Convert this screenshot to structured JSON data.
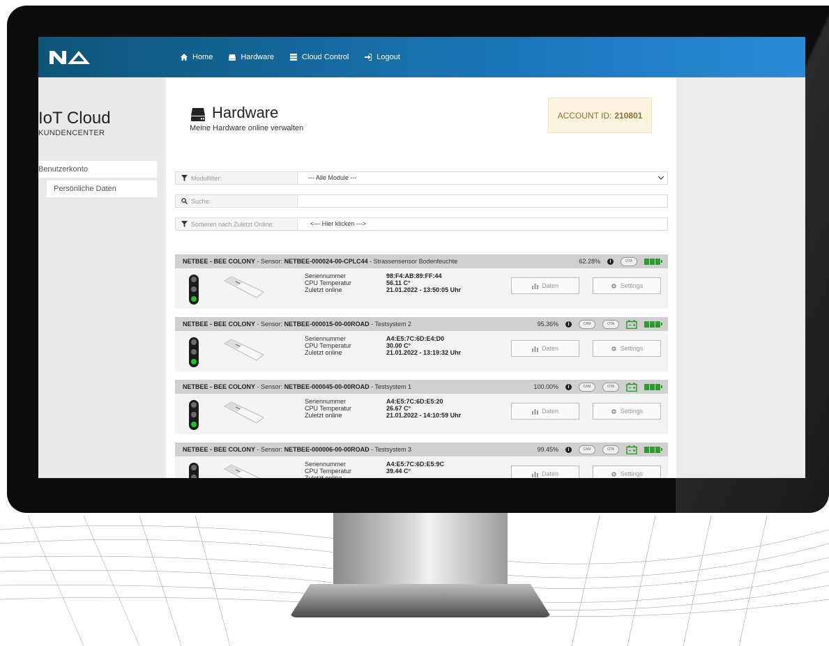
{
  "nav": {
    "home": "Home",
    "hardware": "Hardware",
    "cloud_control": "Cloud Control",
    "logout": "Logout"
  },
  "sidebar": {
    "title": "IoT Cloud",
    "subtitle": "KUNDENCENTER",
    "section": "Benutzerkonto",
    "item": "Persönliche Daten"
  },
  "header": {
    "title": "Hardware",
    "subtitle": "Meine Hardware online verwalten",
    "account_label": "ACCOUNT ID:",
    "account_id": "210801"
  },
  "filters": {
    "module_label": "Modulfilter:",
    "module_value": "--- Alle Module ---",
    "search_label": "Suche:",
    "sort_label": "Sortieren nach Zuletzt Online:",
    "sort_value": "<--- Hier klicken --->"
  },
  "spec_labels": {
    "serial": "Seriennummer",
    "cpu": "CPU Temperatur",
    "online": "Zuletzt online"
  },
  "buttons": {
    "data": "Daten",
    "settings": "Settings"
  },
  "device_prefix": "NETBEE - BEE COLONY",
  "sensor_label": "- Sensor:",
  "badges": {
    "cam": "CAM",
    "ota": "OTA"
  },
  "devices": [
    {
      "id": "NETBEE-000024-00-CPLC44",
      "name": "Strassensensor Bodenfeuchte",
      "percent": "62.28%",
      "serial": "98:F4:AB:89:FF:44",
      "cpu": "56.11 C°",
      "online": "21.01.2022 - 13:50:05 Uhr"
    },
    {
      "id": "NETBEE-000015-00-00ROAD",
      "name": "Testsystem 2",
      "percent": "95.36%",
      "serial": "A4:E5:7C:6D:E4:D0",
      "cpu": "30.00 C°",
      "online": "21.01.2022 - 13:19:32 Uhr"
    },
    {
      "id": "NETBEE-000045-00-00ROAD",
      "name": "Testsystem 1",
      "percent": "100.00%",
      "serial": "A4:E5:7C:6D:E5:20",
      "cpu": "26.67 C°",
      "online": "21.01.2022 - 14:10:59 Uhr"
    },
    {
      "id": "NETBEE-000006-00-00ROAD",
      "name": "Testsystem 3",
      "percent": "99.45%",
      "serial": "A4:E5:7C:6D:E5:9C",
      "cpu": "39.44 C°",
      "online": ""
    }
  ],
  "colors": {
    "topbar": "#1b76b8",
    "status_green": "#2e9b2e",
    "account_bg": "#fdf4df"
  }
}
